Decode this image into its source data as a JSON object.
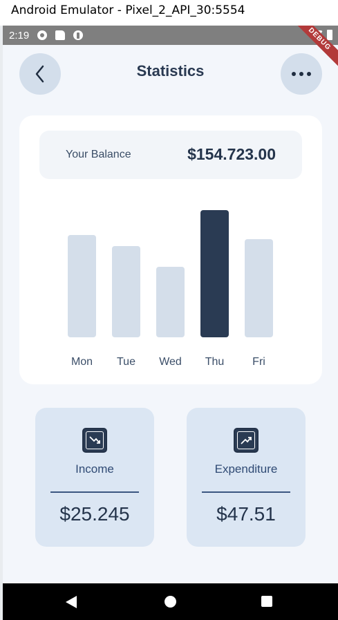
{
  "window": {
    "title": "Android Emulator - Pixel_2_API_30:5554"
  },
  "status_bar": {
    "time": "2:19",
    "icons": [
      "gear-icon",
      "sdcard-icon",
      "circle-icon"
    ],
    "debug_label": "DEBUG"
  },
  "app_bar": {
    "title": "Statistics",
    "back_icon": "chevron-left-icon",
    "more_icon": "more-dots-icon"
  },
  "balance": {
    "label": "Your Balance",
    "value": "$154.723.00"
  },
  "weekly_chart": {
    "days": [
      {
        "label": "Mon",
        "level": 0.74,
        "active": false
      },
      {
        "label": "Tue",
        "level": 0.66,
        "active": false
      },
      {
        "label": "Wed",
        "level": 0.51,
        "active": false
      },
      {
        "label": "Thu",
        "level": 0.92,
        "active": true
      },
      {
        "label": "Fri",
        "level": 0.71,
        "active": false
      }
    ],
    "colors": {
      "inactive": "#d4deea",
      "active": "#2a3b53"
    }
  },
  "tiles": {
    "income": {
      "label": "Income",
      "value": "$25.245",
      "icon": "trending-down-icon"
    },
    "expenditure": {
      "label": "Expenditure",
      "value": "$47.51",
      "icon": "trending-up-icon"
    }
  },
  "colors": {
    "background": "#f3f6fb",
    "accent": "#2a3b53",
    "tile": "#dbe6f3"
  }
}
